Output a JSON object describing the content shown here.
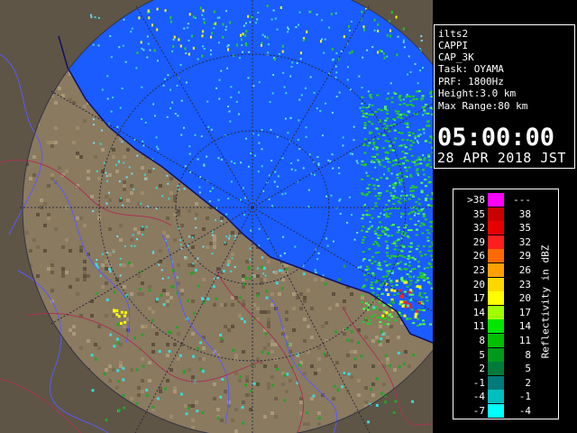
{
  "info": {
    "radar": "ilts2",
    "product": "CAPPI",
    "code": "CAP_3K",
    "task": "Task: OYAMA",
    "prf": "PRF: 1800Hz",
    "height": "Height:3.0 km",
    "max_range": "Max Range:80 km",
    "time": "05:00:00",
    "date": "28 APR 2018 JST"
  },
  "legend": {
    "unit": "Reflectivity in dBZ",
    "rows": [
      {
        "lo": ">38",
        "hi": "---",
        "color": "#ff00ff"
      },
      {
        "lo": "35",
        "hi": "38",
        "color": "#c80000"
      },
      {
        "lo": "32",
        "hi": "35",
        "color": "#e60000"
      },
      {
        "lo": "29",
        "hi": "32",
        "color": "#ff1e1e"
      },
      {
        "lo": "26",
        "hi": "29",
        "color": "#ff6a00"
      },
      {
        "lo": "23",
        "hi": "26",
        "color": "#ffa000"
      },
      {
        "lo": "20",
        "hi": "23",
        "color": "#ffd700"
      },
      {
        "lo": "17",
        "hi": "20",
        "color": "#ffff00"
      },
      {
        "lo": "14",
        "hi": "17",
        "color": "#9fff00"
      },
      {
        "lo": "11",
        "hi": "14",
        "color": "#00e600"
      },
      {
        "lo": "8",
        "hi": "11",
        "color": "#00c000"
      },
      {
        "lo": "5",
        "hi": "8",
        "color": "#009a1a"
      },
      {
        "lo": "2",
        "hi": "5",
        "color": "#007a3a"
      },
      {
        "lo": "-1",
        "hi": "2",
        "color": "#007a7a"
      },
      {
        "lo": "-4",
        "hi": "-1",
        "color": "#00bfbf"
      },
      {
        "lo": "-7",
        "hi": "-4",
        "color": "#00ffff"
      }
    ]
  },
  "map": {
    "sea_color": "#1a5cff",
    "land_color": "#7a6a52",
    "outside_color": "#5e5546",
    "colors": {
      "rain_green": "#22cc22",
      "rain_cyan": "#40d8d8",
      "rain_yellow": "#ffff00",
      "rain_red": "#ff2020",
      "river": "#5a5aff",
      "border": "#aa3355"
    }
  }
}
